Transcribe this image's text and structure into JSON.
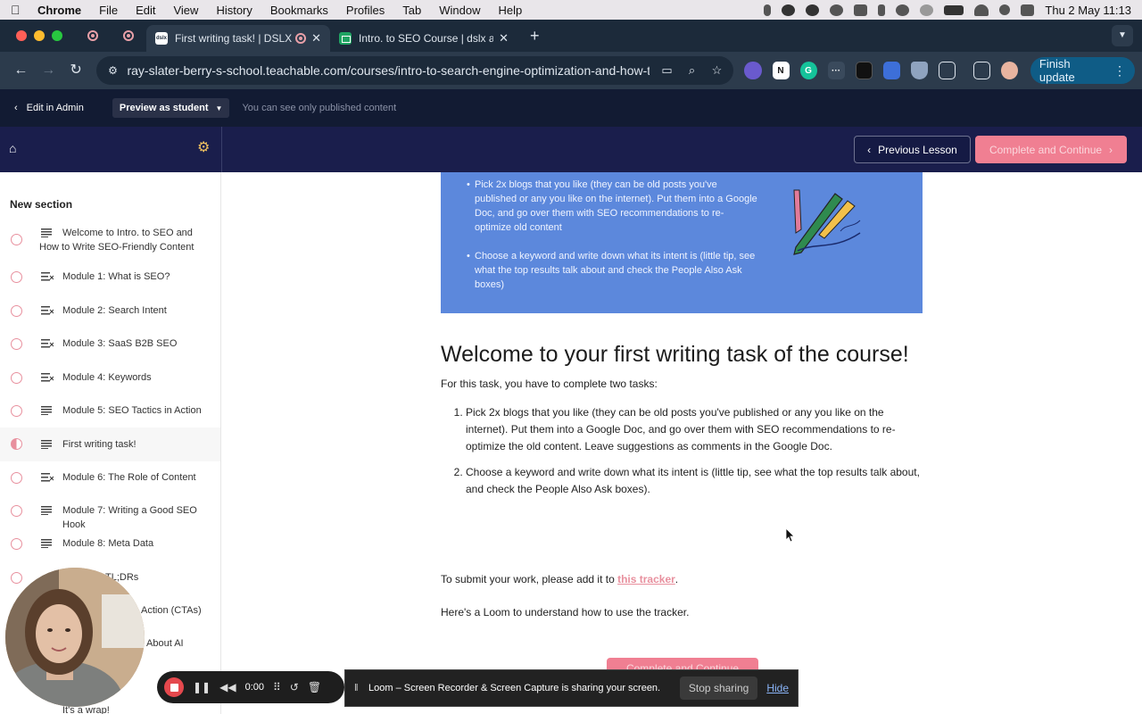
{
  "menubar": {
    "app": "Chrome",
    "items": [
      "File",
      "Edit",
      "View",
      "History",
      "Bookmarks",
      "Profiles",
      "Tab",
      "Window",
      "Help"
    ],
    "datetime": "Thu 2 May  11:13"
  },
  "tabs": {
    "active_title": "First writing task! | DSLX",
    "active_favicon": "dslx",
    "inactive_title": "Intro. to SEO Course | dslx ac",
    "new_tab": "+"
  },
  "toolbar": {
    "url": "ray-slater-berry-s-school.teachable.com/courses/intro-to-search-engine-optimization-and-how-t...",
    "finish_update": "Finish update"
  },
  "admin": {
    "edit_in_admin": "Edit in Admin",
    "preview_as": "Preview as student",
    "note": "You can see only published content"
  },
  "header": {
    "previous_lesson": "Previous Lesson",
    "complete_continue": "Complete and Continue"
  },
  "sidebar": {
    "section_title": "New section",
    "lessons": [
      {
        "label": "Welcome to Intro. to SEO and How to Write SEO-Friendly Content",
        "icon": "text-icon",
        "status": "incomplete"
      },
      {
        "label": "Module 1: What is SEO?",
        "icon": "quiz-icon",
        "status": "incomplete"
      },
      {
        "label": "Module 2: Search Intent",
        "icon": "quiz-icon",
        "status": "incomplete"
      },
      {
        "label": "Module 3: SaaS B2B SEO",
        "icon": "quiz-icon",
        "status": "incomplete"
      },
      {
        "label": "Module 4: Keywords",
        "icon": "quiz-icon",
        "status": "incomplete"
      },
      {
        "label": "Module 5: SEO Tactics in Action",
        "icon": "text-icon",
        "status": "incomplete"
      },
      {
        "label": "First writing task!",
        "icon": "text-icon",
        "status": "in-progress"
      },
      {
        "label": "Module 6: The Role of Content",
        "icon": "quiz-icon",
        "status": "incomplete"
      },
      {
        "label": "Module 7: Writing a Good SEO Hook",
        "icon": "text-icon",
        "status": "incomplete"
      },
      {
        "label": "Module 8: Meta Data",
        "icon": "text-icon",
        "status": "incomplete"
      },
      {
        "label": "TL;DRs",
        "icon": "text-icon",
        "status": "incomplete"
      },
      {
        "label": "Action (CTAs)",
        "icon": "text-icon",
        "status": "incomplete"
      },
      {
        "label": "About AI",
        "icon": "text-icon",
        "status": "incomplete"
      },
      {
        "label": "It's a wrap!",
        "icon": "text-icon",
        "status": "incomplete"
      }
    ]
  },
  "hero": {
    "bullets": [
      "Pick 2x blogs that you like (they can be old posts you've published or any you like on the internet). Put them into a Google Doc, and go over them with SEO recommendations to re-optimize old content",
      "Choose a keyword and write down what its intent is (little tip, see what the top results talk about and check the People Also Ask boxes)"
    ]
  },
  "article": {
    "heading": "Welcome to your first writing task of the course!",
    "intro": "For this task, you have to complete two tasks:",
    "tasks": [
      "Pick 2x blogs that you like (they can be old posts you've published or any you like on the internet). Put them into a Google Doc, and go over them with SEO recommendations to re-optimize the old content. Leave suggestions as comments in the Google Doc.",
      "Choose a keyword and write down what its intent is (little tip, see what the top results talk about, and check the People Also Ask boxes)."
    ],
    "submit_prefix": "To submit your work, please add it to ",
    "submit_link": "this tracker",
    "submit_suffix": ".",
    "loom_line": "Here's a Loom to understand how to use the tracker.",
    "bottom_button": "Complete and Continue"
  },
  "loom": {
    "timer": "0:00",
    "share_message": "Loom – Screen Recorder & Screen Capture is sharing your screen.",
    "stop_sharing": "Stop sharing",
    "hide": "Hide"
  },
  "colors": {
    "accent_pink": "#f07f92",
    "header_navy": "#1a1e4c",
    "hero_blue": "#5c88dc",
    "chrome_dark": "#2c3b4c"
  }
}
